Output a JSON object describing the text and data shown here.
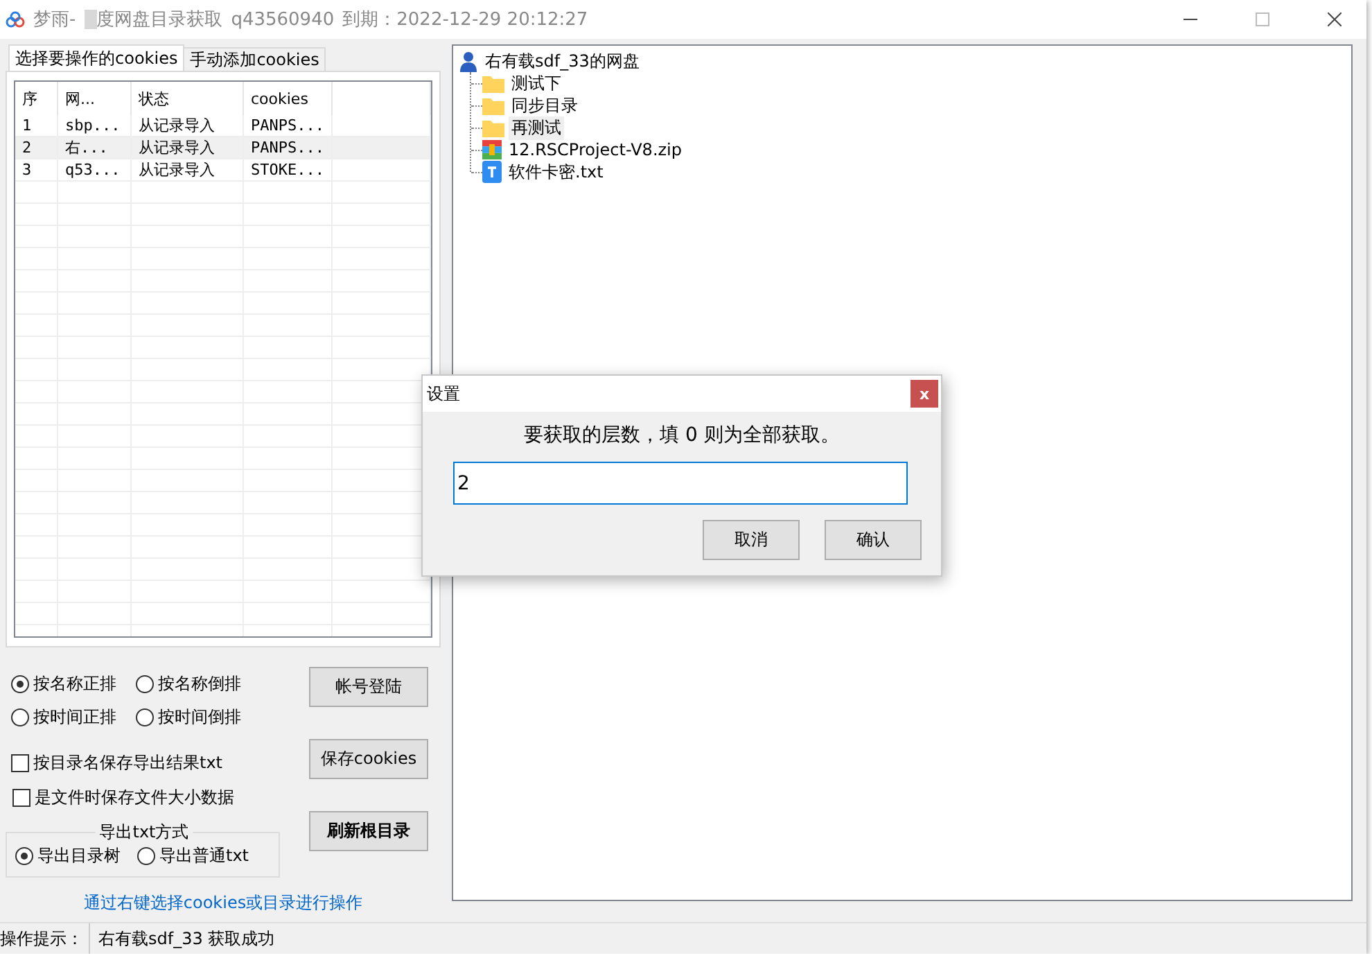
{
  "window": {
    "title_prefix": "梦雨-",
    "title_rest": "度网盘目录获取",
    "account": "q43560940",
    "expiry": "到期：2022-12-29 20:12:27"
  },
  "tabs": [
    {
      "label": "选择要操作的cookies",
      "selected": true
    },
    {
      "label": "手动添加cookies",
      "selected": false
    }
  ],
  "table": {
    "columns": [
      "序",
      "网...",
      "状态",
      "cookies"
    ],
    "rows": [
      {
        "cells": [
          "1",
          "sbp...",
          "从记录导入",
          "PANPS..."
        ],
        "selected": false
      },
      {
        "cells": [
          "2",
          "右...",
          "从记录导入",
          "PANPS..."
        ],
        "selected": true
      },
      {
        "cells": [
          "3",
          "q53...",
          "从记录导入",
          "STOKE..."
        ],
        "selected": false
      }
    ]
  },
  "sort_options": [
    {
      "label": "按名称正排",
      "selected": true
    },
    {
      "label": "按名称倒排",
      "selected": false
    },
    {
      "label": "按时间正排",
      "selected": false
    },
    {
      "label": "按时间倒排",
      "selected": false
    }
  ],
  "checkboxes": [
    {
      "label": "按目录名保存导出结果txt",
      "checked": false
    },
    {
      "label": "是文件时保存文件大小数据",
      "checked": false
    }
  ],
  "export_group": {
    "title": "导出txt方式",
    "options": [
      {
        "label": "导出目录树",
        "selected": true
      },
      {
        "label": "导出普通txt",
        "selected": false
      }
    ]
  },
  "buttons": [
    {
      "label": "帐号登陆",
      "bold": false
    },
    {
      "label": "保存cookies",
      "bold": false
    },
    {
      "label": "刷新根目录",
      "bold": true
    }
  ],
  "hint_link": "通过右键选择cookies或目录进行操作",
  "tree": {
    "label": "右有载sdf_33的网盘",
    "kind": "user",
    "children": [
      {
        "label": "测试下",
        "kind": "folder",
        "selected": false
      },
      {
        "label": "同步目录",
        "kind": "folder",
        "selected": false
      },
      {
        "label": "再测试",
        "kind": "folder",
        "selected": true
      },
      {
        "label": "12.RSCProject-V8.zip",
        "kind": "zip",
        "selected": false
      },
      {
        "label": "软件卡密.txt",
        "kind": "txt",
        "selected": false
      }
    ]
  },
  "status_bar": {
    "label": "操作提示：",
    "message": "右有载sdf_33 获取成功"
  },
  "dialog": {
    "title": "设置",
    "close": "x",
    "prompt": "要获取的层数，填 0 则为全部获取。",
    "value": "2",
    "buttons": [
      "取消",
      "确认"
    ]
  }
}
